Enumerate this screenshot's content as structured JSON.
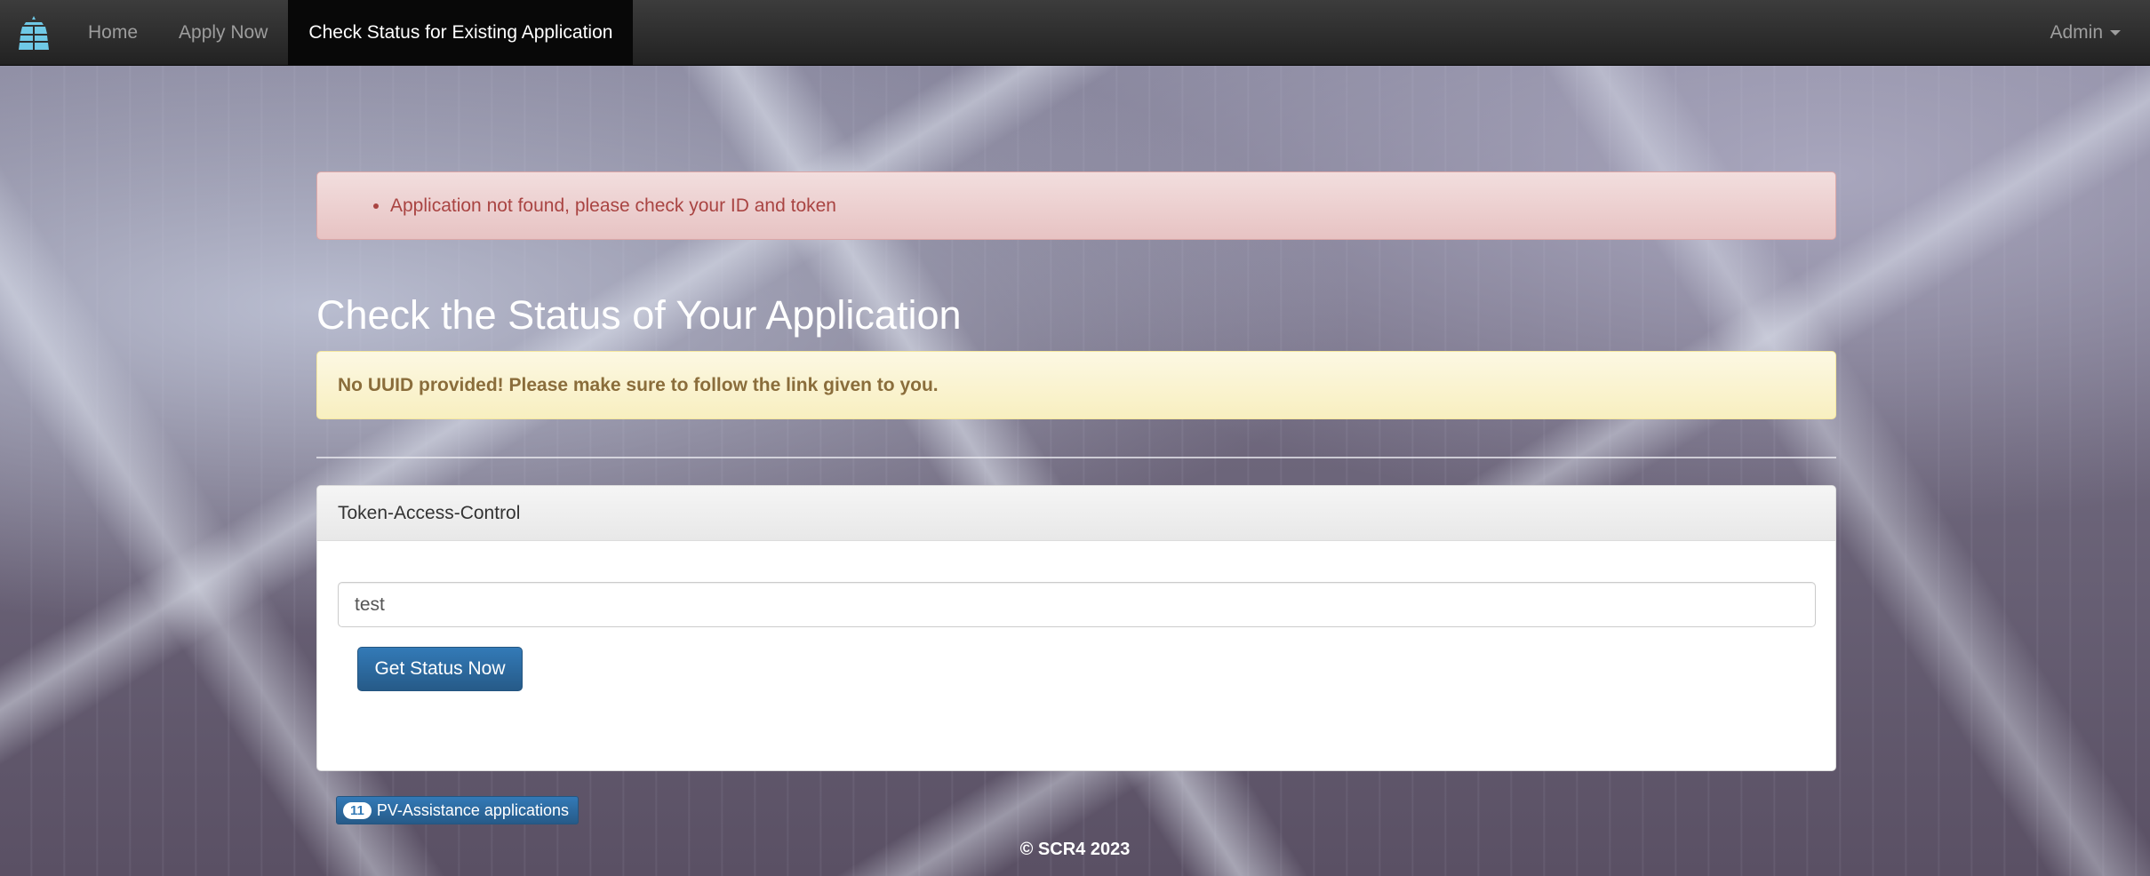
{
  "navbar": {
    "brand_icon": "solar-panel-icon",
    "items": [
      {
        "label": "Home"
      },
      {
        "label": "Apply Now"
      },
      {
        "label": "Check Status for Existing Application"
      }
    ],
    "admin_label": "Admin"
  },
  "alerts": {
    "error": "Application not found, please check your ID and token",
    "warning": "No UUID provided! Please make sure to follow the link given to you."
  },
  "page": {
    "title": "Check the Status of Your Application"
  },
  "panel": {
    "heading": "Token-Access-Control",
    "token_value": "test",
    "submit_label": "Get Status Now"
  },
  "applications": {
    "count": "11",
    "label": "PV-Assistance applications"
  },
  "footer": {
    "text": "© SCR4 2023"
  },
  "colors": {
    "primary": "#337ab7",
    "danger_text": "#a94442",
    "warning_text": "#8a6d3b",
    "navbar": "#222222"
  }
}
